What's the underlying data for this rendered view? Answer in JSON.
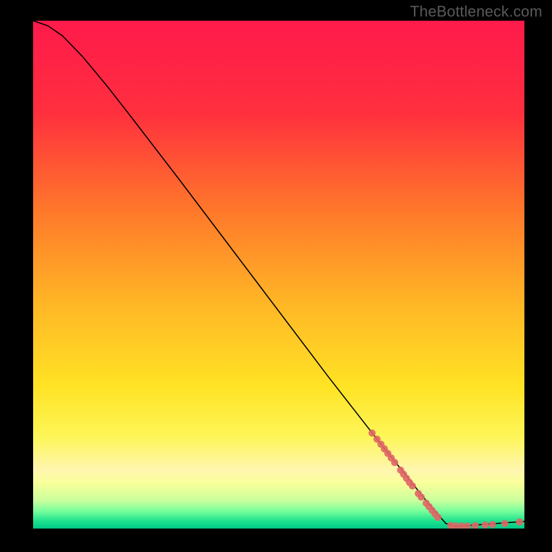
{
  "attribution": "TheBottleneck.com",
  "chart_data": {
    "type": "line",
    "title": "",
    "xlabel": "",
    "ylabel": "",
    "xlim": [
      0,
      100
    ],
    "ylim": [
      0,
      100
    ],
    "gradient_stops": [
      {
        "offset": 0.0,
        "color": "#ff1a4b"
      },
      {
        "offset": 0.18,
        "color": "#ff2f3e"
      },
      {
        "offset": 0.38,
        "color": "#ff7a2a"
      },
      {
        "offset": 0.56,
        "color": "#ffb726"
      },
      {
        "offset": 0.72,
        "color": "#ffe324"
      },
      {
        "offset": 0.82,
        "color": "#fdf659"
      },
      {
        "offset": 0.885,
        "color": "#fffota"
      },
      {
        "offset": 0.91,
        "color": "#f9ff9a"
      },
      {
        "offset": 0.945,
        "color": "#c9ff9c"
      },
      {
        "offset": 0.965,
        "color": "#7aff9c"
      },
      {
        "offset": 0.985,
        "color": "#1fe28e"
      },
      {
        "offset": 1.0,
        "color": "#00c987"
      }
    ],
    "curve": [
      {
        "x": 0.0,
        "y": 100.0
      },
      {
        "x": 3.0,
        "y": 99.0
      },
      {
        "x": 6.0,
        "y": 97.0
      },
      {
        "x": 10.0,
        "y": 93.0
      },
      {
        "x": 15.0,
        "y": 87.2
      },
      {
        "x": 20.0,
        "y": 81.0
      },
      {
        "x": 30.0,
        "y": 68.4
      },
      {
        "x": 40.0,
        "y": 55.6
      },
      {
        "x": 50.0,
        "y": 42.8
      },
      {
        "x": 60.0,
        "y": 30.0
      },
      {
        "x": 70.0,
        "y": 17.6
      },
      {
        "x": 80.0,
        "y": 5.5
      },
      {
        "x": 84.0,
        "y": 1.0
      },
      {
        "x": 86.0,
        "y": 0.4
      },
      {
        "x": 100.0,
        "y": 1.4
      }
    ],
    "cluster_points": [
      {
        "x": 69.0,
        "y": 18.8
      },
      {
        "x": 70.0,
        "y": 17.6
      },
      {
        "x": 70.8,
        "y": 16.6
      },
      {
        "x": 71.5,
        "y": 15.7
      },
      {
        "x": 72.2,
        "y": 14.8
      },
      {
        "x": 72.9,
        "y": 13.9
      },
      {
        "x": 73.6,
        "y": 13.0
      },
      {
        "x": 74.8,
        "y": 11.5
      },
      {
        "x": 75.4,
        "y": 10.7
      },
      {
        "x": 76.0,
        "y": 9.9
      },
      {
        "x": 76.6,
        "y": 9.1
      },
      {
        "x": 77.2,
        "y": 8.4
      },
      {
        "x": 78.4,
        "y": 6.9
      },
      {
        "x": 79.0,
        "y": 6.2
      },
      {
        "x": 80.0,
        "y": 5.0
      },
      {
        "x": 80.6,
        "y": 4.3
      },
      {
        "x": 81.2,
        "y": 3.6
      },
      {
        "x": 81.8,
        "y": 2.9
      },
      {
        "x": 82.4,
        "y": 2.2
      },
      {
        "x": 85.0,
        "y": 0.6
      },
      {
        "x": 86.0,
        "y": 0.5
      },
      {
        "x": 87.2,
        "y": 0.5
      },
      {
        "x": 88.4,
        "y": 0.5
      },
      {
        "x": 90.0,
        "y": 0.6
      },
      {
        "x": 92.0,
        "y": 0.7
      },
      {
        "x": 93.5,
        "y": 0.8
      },
      {
        "x": 96.0,
        "y": 1.0
      },
      {
        "x": 99.0,
        "y": 1.3
      }
    ],
    "point_style": {
      "fill": "#e06666",
      "fill_opacity": 0.9,
      "radius": 5.2
    },
    "line_style": {
      "stroke": "#000000",
      "width": 1.6
    }
  }
}
